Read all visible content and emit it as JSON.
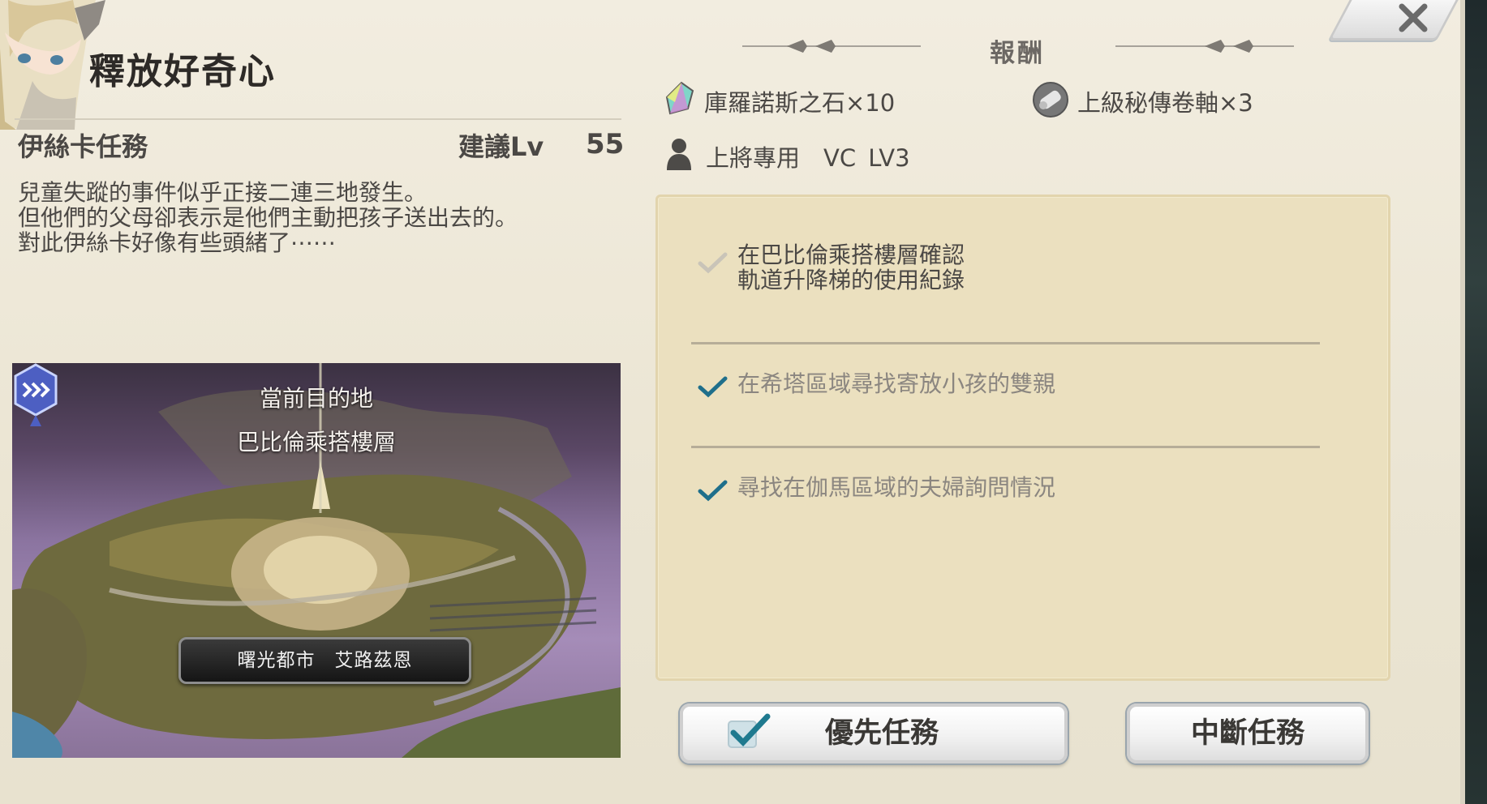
{
  "quest": {
    "title": "釋放好奇心",
    "type": "伊絲卡任務",
    "recommended_lv_label": "建議Lv",
    "recommended_lv": "55",
    "description": [
      "兒童失蹤的事件似乎正接二連三地發生。",
      "但他們的父母卻表示是他們主動把孩子送出去的。",
      "對此伊絲卡好像有些頭緒了⋯⋯"
    ]
  },
  "map": {
    "destination_label": "當前目的地",
    "destination_name": "巴比倫乘搭樓層",
    "location_name": "曙光都市　艾路茲恩"
  },
  "rewards": {
    "header": "報酬",
    "items": [
      {
        "icon": "crystal-stone-icon",
        "label": "庫羅諾斯之石×10"
      },
      {
        "icon": "scroll-icon",
        "label": "上級秘傳卷軸×3"
      }
    ],
    "requirement": {
      "icon": "person-icon",
      "label": "上將專用　VC LV3"
    }
  },
  "objectives": [
    {
      "lines": [
        "在巴比倫乘搭樓層確認",
        "軌道升降梯的使用紀錄"
      ],
      "completed": false
    },
    {
      "lines": [
        "在希塔區域尋找寄放小孩的雙親"
      ],
      "completed": true
    },
    {
      "lines": [
        "尋找在伽馬區域的夫婦詢問情況"
      ],
      "completed": true
    }
  ],
  "buttons": {
    "priority": "優先任務",
    "abort": "中斷任務",
    "close": "close-icon"
  },
  "colors": {
    "check_done": "#1f6f8b",
    "check_pending": "#c9c4b8",
    "text_dark": "#4b4845",
    "text_muted": "#8b8680",
    "panel_bg": "#ece6d6",
    "objective_bg": "#ebe0bf"
  }
}
